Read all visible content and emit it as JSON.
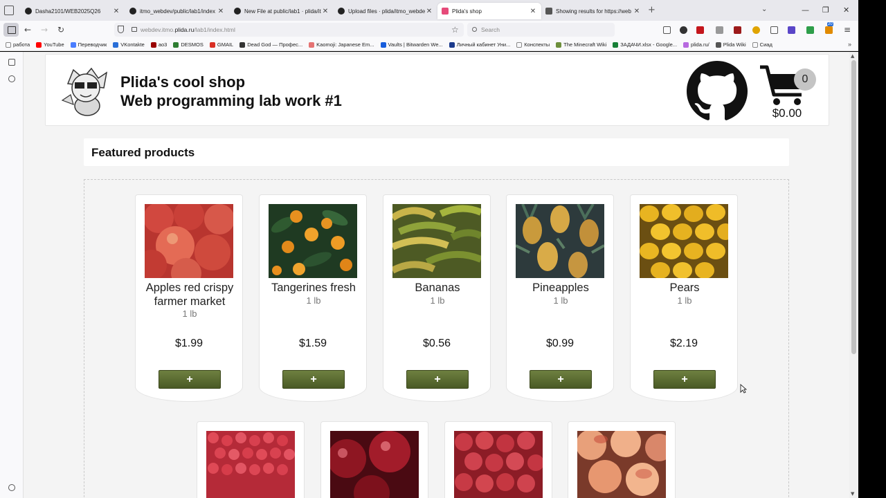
{
  "browser": {
    "tabs": [
      {
        "title": "Dasha2101/WEB2025Q26",
        "active": false
      },
      {
        "title": "itmo_webdev/public/lab1/index",
        "active": false
      },
      {
        "title": "New File at public/lab1 · plida/it",
        "active": false
      },
      {
        "title": "Upload files · plida/itmo_webde",
        "active": false
      },
      {
        "title": "Plida's shop",
        "active": true
      },
      {
        "title": "Showing results for https://web",
        "active": false
      }
    ],
    "url_prefix": "webdev.itmo.",
    "url_host": "plida.ru",
    "url_path": "/lab1/index.html",
    "search_placeholder": "Search",
    "ext_badge": "20",
    "bookmarks": [
      {
        "label": "работа",
        "color": "#888888"
      },
      {
        "label": "YouTube",
        "color": "#ff0000"
      },
      {
        "label": "Переводчик",
        "color": "#4a7dff"
      },
      {
        "label": "VKontakte",
        "color": "#2a6fd8"
      },
      {
        "label": "ao3",
        "color": "#990000"
      },
      {
        "label": "DESMOS",
        "color": "#2e7d32"
      },
      {
        "label": "GMAIL",
        "color": "#d93025"
      },
      {
        "label": "Dead God — Профес...",
        "color": "#333333"
      },
      {
        "label": "Kaomoji: Japanese Em...",
        "color": "#e57373"
      },
      {
        "label": "Vaults | Bitwarden We...",
        "color": "#175ddc"
      },
      {
        "label": "Личный кабинет Уни...",
        "color": "#1b3a8c"
      },
      {
        "label": "Конспекты",
        "color": "#888888"
      },
      {
        "label": "The Minecraft Wiki",
        "color": "#6d8f3c"
      },
      {
        "label": "ЗАДАЧИ.xlsx - Google...",
        "color": "#188038"
      },
      {
        "label": "plida.ru/",
        "color": "#b76ae0"
      },
      {
        "label": "Plida Wiki",
        "color": "#555555"
      },
      {
        "label": "Сиад",
        "color": "#888888"
      }
    ]
  },
  "header": {
    "title": "Plida's cool shop",
    "subtitle": "Web programming lab work #1",
    "cart_count": "0",
    "cart_total": "$0.00"
  },
  "featured": {
    "title": "Featured products"
  },
  "products": [
    {
      "name": "Apples red crispy farmer market",
      "unit": "1 lb",
      "price": "$1.99",
      "add_label": "+"
    },
    {
      "name": "Tangerines fresh",
      "unit": "1 lb",
      "price": "$1.59",
      "add_label": "+"
    },
    {
      "name": "Bananas",
      "unit": "1 lb",
      "price": "$0.56",
      "add_label": "+"
    },
    {
      "name": "Pineapples",
      "unit": "1 lb",
      "price": "$0.99",
      "add_label": "+"
    },
    {
      "name": "Pears",
      "unit": "1 lb",
      "price": "$2.19",
      "add_label": "+"
    }
  ],
  "colors": {
    "add_button": "#5b6d32",
    "apples": "#c9473f",
    "tangerines": "#e08a1e",
    "bananas": "#b3a24a",
    "pineapples": "#c99a3c",
    "pears": "#e7b420",
    "row2_a": "#d9434f",
    "row2_b": "#8e1622",
    "row2_c": "#c83a46",
    "row2_d": "#e8a07a"
  }
}
